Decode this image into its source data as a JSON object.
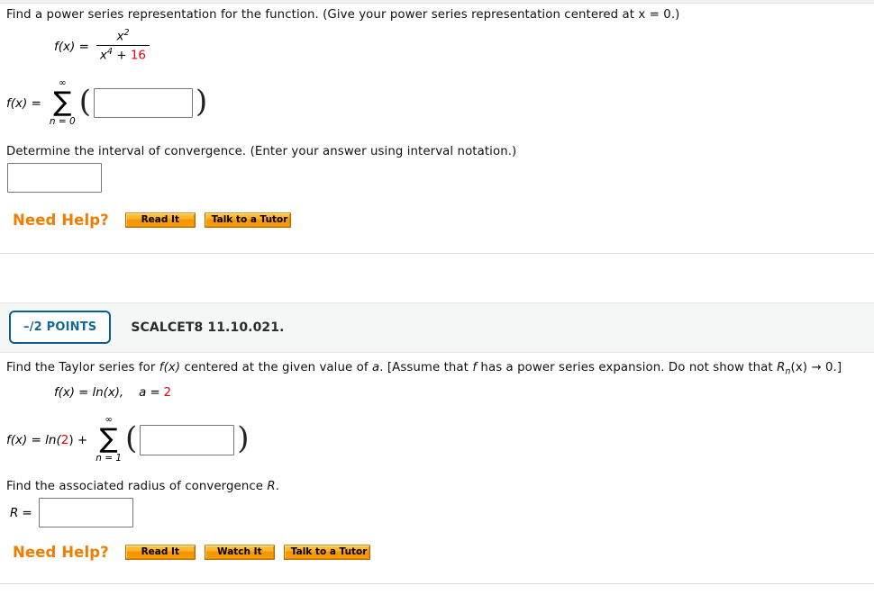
{
  "problem1": {
    "prompt": "Find a power series representation for the function. (Give your power series representation centered at x = 0.)",
    "function_label": "f(x) =",
    "fraction": {
      "numerator_base": "x",
      "numerator_exp": "2",
      "denominator_base": "x",
      "denominator_exp": "4",
      "denominator_plus": "+",
      "denominator_const": "16"
    },
    "series_label": "f(x) =",
    "sigma": {
      "top": "∞",
      "symbol": "∑",
      "bottom": "n = 0"
    },
    "open_paren": "(",
    "close_paren": ")",
    "answer_value": "",
    "answer_placeholder": "",
    "interval_prompt": "Determine the interval of convergence. (Enter your answer using interval notation.)",
    "interval_value": "",
    "interval_placeholder": "",
    "need_help_label": "Need Help?",
    "help_buttons": [
      "Read It",
      "Talk to a Tutor"
    ]
  },
  "problem2": {
    "points_badge": "–/2 POINTS",
    "question_code": "SCALCET8 11.10.021.",
    "prompt_part1": "Find the Taylor series for ",
    "prompt_fx": "f(x)",
    "prompt_part2": " centered at the given value of ",
    "prompt_a": "a",
    "prompt_part3": ". [Assume that ",
    "prompt_f": "f",
    "prompt_part4": " has a power series expansion. Do not show that ",
    "prompt_R": "R",
    "prompt_Rsub": "n",
    "prompt_part5": "(x) → 0.]",
    "given_fx": "f(x) = ln(x),",
    "given_a_label": "a =",
    "given_a_value": "2",
    "series_prefix": "f(x) = ln(",
    "series_prefix_value": "2",
    "series_prefix_suffix": ") +",
    "sigma": {
      "top": "∞",
      "symbol": "∑",
      "bottom": "n = 1"
    },
    "open_paren": "(",
    "close_paren": ")",
    "answer_value": "",
    "answer_placeholder": "",
    "radius_prompt_part1": "Find the associated radius of convergence ",
    "radius_prompt_R": "R",
    "radius_prompt_part2": ".",
    "radius_label_R": "R",
    "radius_label_eq": "=",
    "radius_value": "",
    "radius_placeholder": "",
    "need_help_label": "Need Help?",
    "help_buttons": [
      "Read It",
      "Watch It",
      "Talk to a Tutor"
    ]
  },
  "colors": {
    "accent_red": "#e8000b",
    "accent_orange": "#f07d00",
    "badge_blue": "#15679b",
    "band_gray": "#f5f6f6"
  }
}
